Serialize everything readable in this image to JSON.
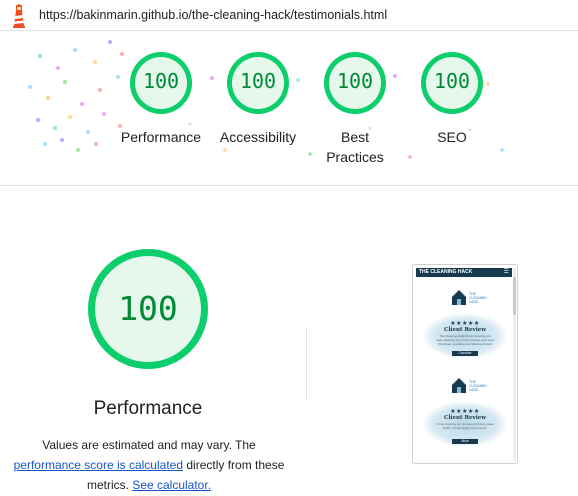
{
  "header": {
    "url": "https://bakinmarin.github.io/the-cleaning-hack/testimonials.html"
  },
  "summary": {
    "gauges": [
      {
        "score": "100",
        "label": "Performance"
      },
      {
        "score": "100",
        "label": "Accessibility"
      },
      {
        "score": "100",
        "label": "Best Practices"
      },
      {
        "score": "100",
        "label": "SEO"
      }
    ]
  },
  "main": {
    "score": "100",
    "title": "Performance",
    "desc_part1": "Values are estimated and may vary. The",
    "link_score": "performance score is calculated",
    "desc_part2": "directly from these metrics.",
    "link_calc": "See calculator."
  },
  "thumbnail": {
    "nav_title": "THE CLEANING HACK",
    "logo_text": "THE CLEANING HACK",
    "stars": "★★★★★",
    "card_title": "Client Review",
    "card1_text": "The Cleaning Hack did an amazing job deep cleaning my house, leaving each spot first clean, sparkling and fabulous finish!",
    "card1_name": "Caroline",
    "card2_text": "A true cleaning pro to come and get a great finish. I would highly recommend.",
    "card2_name": "Alice"
  },
  "colors": {
    "pass_green": "#0cce6b",
    "pass_text": "#008a35",
    "pass_fill": "#e6f7ec",
    "link": "#1a55c8"
  },
  "icons": {
    "logo": "lighthouse-icon",
    "menu": "hamburger-icon",
    "house": "house-icon"
  }
}
